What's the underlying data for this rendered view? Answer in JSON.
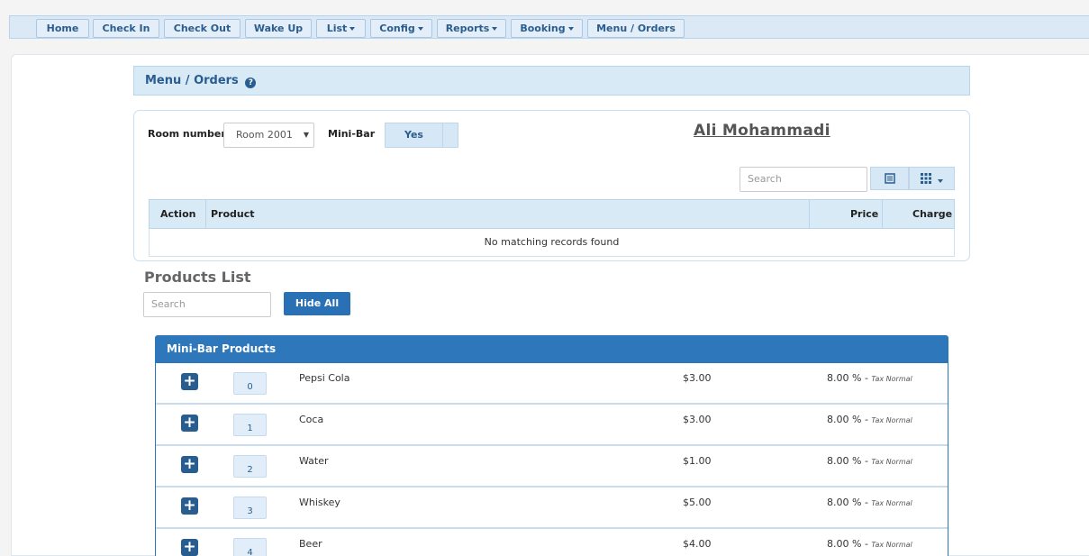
{
  "nav": {
    "items": [
      {
        "label": "Home",
        "dropdown": false
      },
      {
        "label": "Check In",
        "dropdown": false
      },
      {
        "label": "Check Out",
        "dropdown": false
      },
      {
        "label": "Wake Up",
        "dropdown": false
      },
      {
        "label": "List",
        "dropdown": true
      },
      {
        "label": "Config",
        "dropdown": true
      },
      {
        "label": "Reports",
        "dropdown": true
      },
      {
        "label": "Booking",
        "dropdown": true
      },
      {
        "label": "Menu / Orders",
        "dropdown": false
      }
    ]
  },
  "page": {
    "title": "Menu / Orders",
    "help_icon": "question-circle-icon"
  },
  "order_form": {
    "room_label": "Room number",
    "room_value": "Room 2001",
    "minibar_label": "Mini-Bar",
    "minibar_value": "Yes",
    "guest_name": "Ali Mohammadi",
    "search_placeholder": "Search",
    "table": {
      "columns": [
        "Action",
        "Product",
        "Price",
        "Charge"
      ],
      "empty_message": "No matching records found"
    }
  },
  "products": {
    "title": "Products List",
    "search_placeholder": "Search",
    "hide_all_label": "Hide All",
    "group_title": "Mini-Bar Products",
    "items": [
      {
        "index": "0",
        "name": "Pepsi Cola",
        "price": "$3.00",
        "tax": "8.00 % -",
        "tax_type": "Tax Normal"
      },
      {
        "index": "1",
        "name": "Coca",
        "price": "$3.00",
        "tax": "8.00 % -",
        "tax_type": "Tax Normal"
      },
      {
        "index": "2",
        "name": "Water",
        "price": "$1.00",
        "tax": "8.00 % -",
        "tax_type": "Tax Normal"
      },
      {
        "index": "3",
        "name": "Whiskey",
        "price": "$5.00",
        "tax": "8.00 % -",
        "tax_type": "Tax Normal"
      },
      {
        "index": "4",
        "name": "Beer",
        "price": "$4.00",
        "tax": "8.00 % -",
        "tax_type": "Tax Normal"
      }
    ]
  },
  "colors": {
    "accent": "#2e77bb",
    "nav_bg": "#dbe9f6",
    "link_text": "#2a5d8f"
  }
}
